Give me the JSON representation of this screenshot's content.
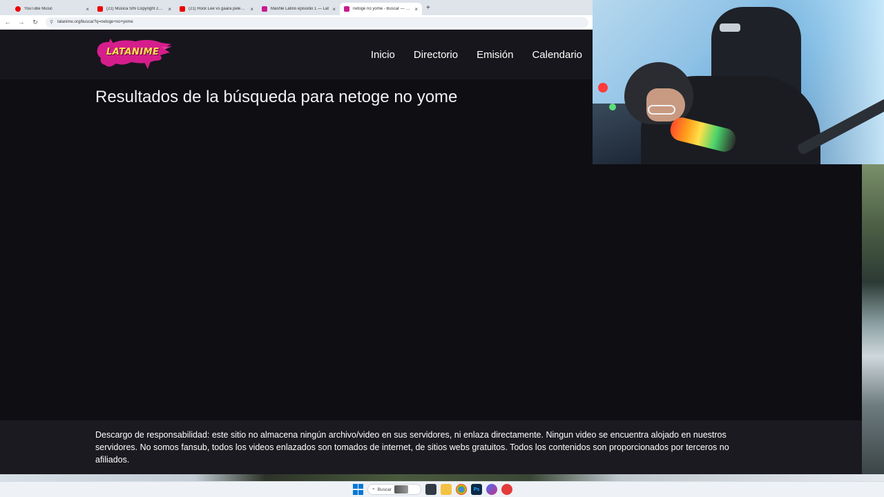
{
  "browser": {
    "tabs": [
      {
        "title": "YouTube Music",
        "icon": "youtube-music-icon",
        "active": false
      },
      {
        "title": "(21) Música SIN Copyright 2024",
        "icon": "youtube-icon",
        "active": false
      },
      {
        "title": "(21) Rock Lee vs gaara pelea co",
        "icon": "youtube-icon",
        "active": false
      },
      {
        "title": "Mashle Latino episodio 1 — Lat",
        "icon": "latanime-icon",
        "active": false
      },
      {
        "title": "netoge no yome - Buscar — Lat",
        "icon": "latanime-icon",
        "active": true
      }
    ],
    "new_tab": "+",
    "close_glyph": "×",
    "back_glyph": "←",
    "forward_glyph": "→",
    "reload_glyph": "↻",
    "site_info_glyph": "⚲",
    "url": "latanime.org/buscar?q=netoge+no+yome"
  },
  "site": {
    "logo_text": "LATANIME",
    "nav": [
      "Inicio",
      "Directorio",
      "Emisión",
      "Calendario"
    ],
    "page_title": "Resultados de la búsqueda para netoge no yome",
    "disclaimer": "Descargo de responsabilidad: este sitio no almacena ningún archivo/video en sus servidores, ni enlaza directamente. Ningun video se encuentra alojado en nuestros servidores. No somos fansub, todos los videos enlazados son tomados de internet, de sitios webs gratuitos. Todos los contenidos son proporcionados por terceros no afiliados."
  },
  "taskbar": {
    "search_placeholder": "Buscar",
    "search_glyph": "⌕",
    "ps_label": "Ps"
  },
  "colors": {
    "header_bg": "#17161c",
    "page_bg": "#0f0e13",
    "footer_bg": "#1b1a20",
    "logo_pink": "#d51e8c",
    "logo_yellow": "#ffe44d"
  }
}
